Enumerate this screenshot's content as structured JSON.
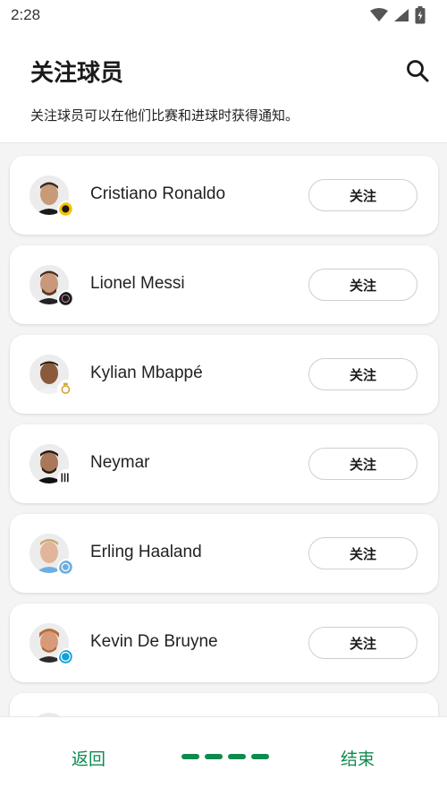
{
  "status": {
    "time": "2:28"
  },
  "header": {
    "title": "关注球员",
    "subtitle": "关注球员可以在他们比赛和进球时获得通知。"
  },
  "players": [
    {
      "name": "Cristiano Ronaldo",
      "follow_label": "关注",
      "badge_color": "#f5c400"
    },
    {
      "name": "Lionel Messi",
      "follow_label": "关注",
      "badge_color": "#1c1c1c"
    },
    {
      "name": "Kylian Mbappé",
      "follow_label": "关注",
      "badge_color": "#ffffff"
    },
    {
      "name": "Neymar",
      "follow_label": "关注",
      "badge_color": "#333333"
    },
    {
      "name": "Erling Haaland",
      "follow_label": "关注",
      "badge_color": "#6caee0"
    },
    {
      "name": "Kevin De Bruyne",
      "follow_label": "关注",
      "badge_color": "#12a0d7"
    }
  ],
  "bottom": {
    "back_label": "返回",
    "finish_label": "结束",
    "accent_color": "#0f8a4f"
  },
  "icons": {
    "search": "search-icon",
    "wifi": "wifi-icon",
    "signal": "signal-icon",
    "battery": "battery-icon"
  }
}
